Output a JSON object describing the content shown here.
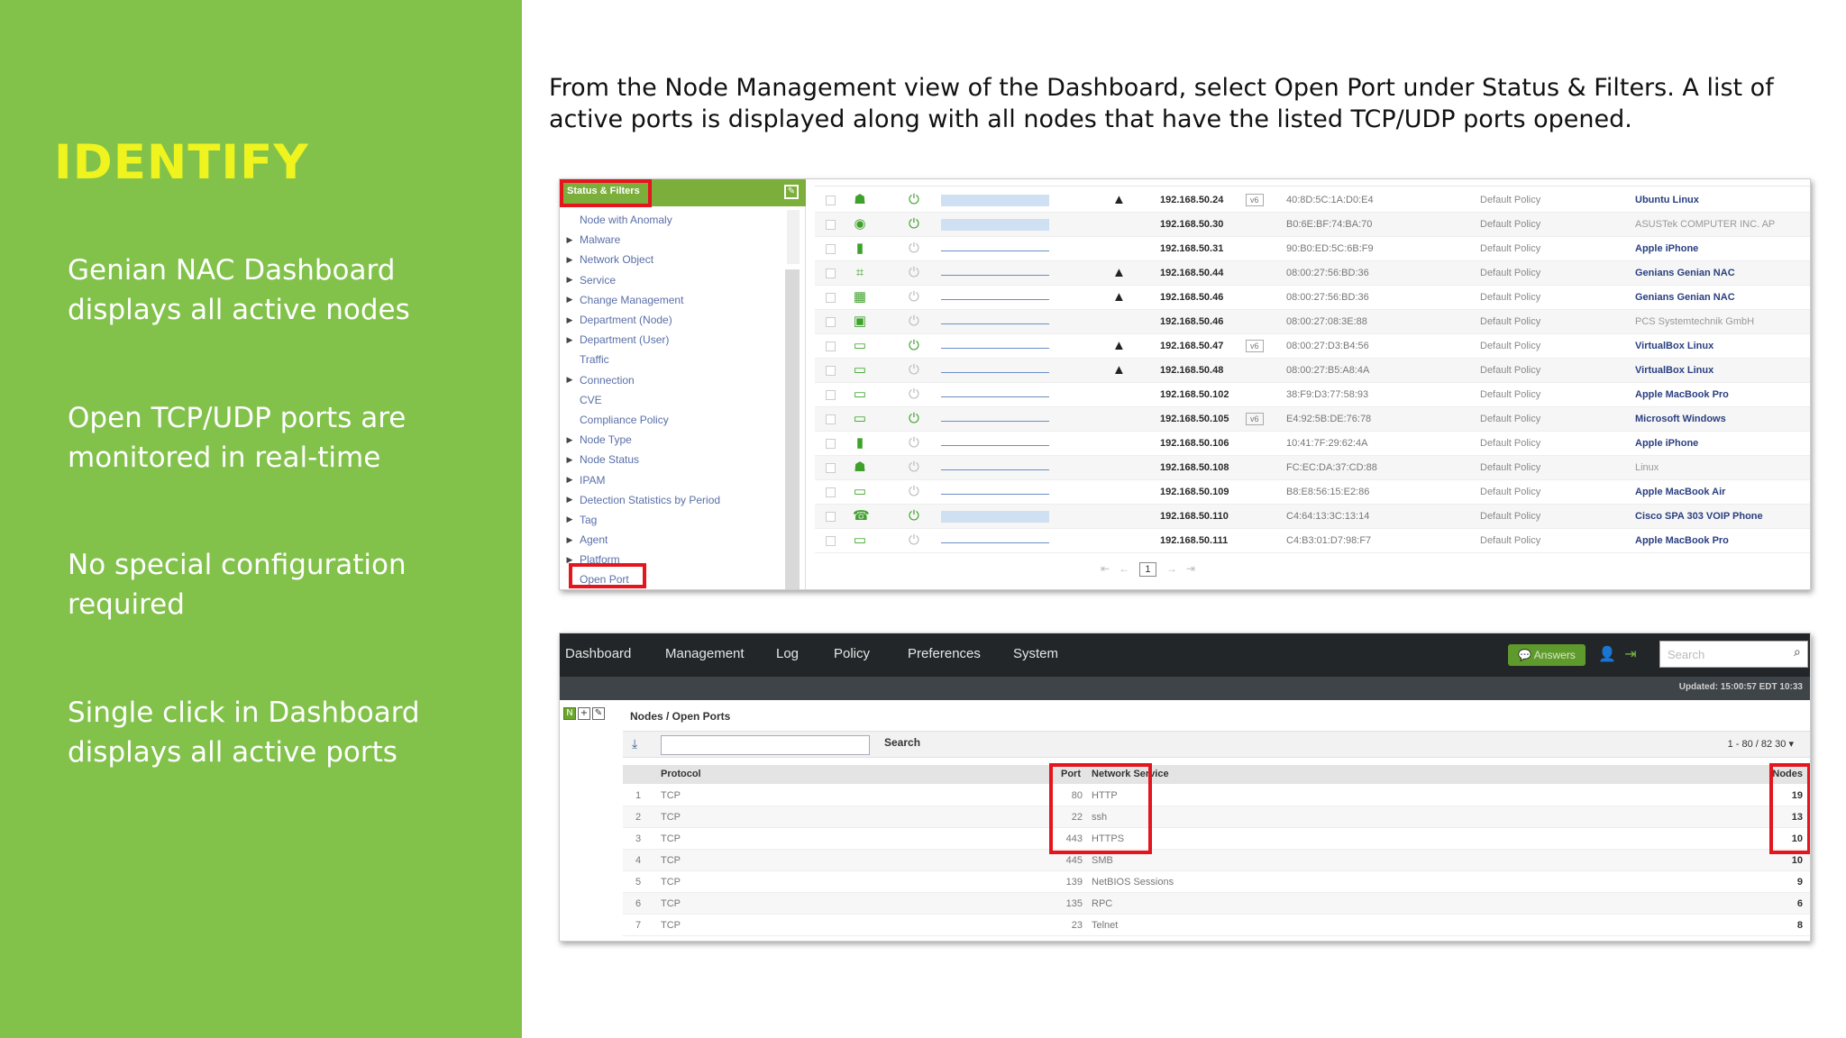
{
  "slide": {
    "title": "IDENTIFY",
    "bullets": [
      "Genian NAC Dashboard displays all active nodes",
      "Open TCP/UDP ports are monitored in real-time",
      "No special configuration required",
      "Single click in Dashboard displays all active ports"
    ],
    "intro": "From the Node Management view of the Dashboard, select Open Port under Status & Filters.  A list of active ports is displayed along with all nodes that have the listed TCP/UDP ports opened."
  },
  "colors": {
    "left_panel": "#82c24b",
    "title": "#f0f41e",
    "highlight": "#e4151d"
  },
  "node_view": {
    "filters_header": "Status & Filters",
    "filters": [
      {
        "label": "Node with Anomaly",
        "expandable": false
      },
      {
        "label": "Malware",
        "expandable": true
      },
      {
        "label": "Network Object",
        "expandable": true
      },
      {
        "label": "Service",
        "expandable": true
      },
      {
        "label": "Change Management",
        "expandable": true
      },
      {
        "label": "Department (Node)",
        "expandable": true
      },
      {
        "label": "Department (User)",
        "expandable": true
      },
      {
        "label": "Traffic",
        "expandable": false
      },
      {
        "label": "Connection",
        "expandable": true
      },
      {
        "label": "CVE",
        "expandable": false
      },
      {
        "label": "Compliance Policy",
        "expandable": false
      },
      {
        "label": "Node Type",
        "expandable": true
      },
      {
        "label": "Node Status",
        "expandable": true
      },
      {
        "label": "IPAM",
        "expandable": true
      },
      {
        "label": "Detection Statistics by Period",
        "expandable": true
      },
      {
        "label": "Tag",
        "expandable": true
      },
      {
        "label": "Agent",
        "expandable": true
      },
      {
        "label": "Platform",
        "expandable": true
      },
      {
        "label": "Open Port",
        "expandable": false
      }
    ],
    "nodes": [
      {
        "icon": "network-icon",
        "power": "on",
        "traffic": "full",
        "warn": true,
        "ip": "192.168.50.24",
        "v6": true,
        "mac": "40:8D:5C:1A:D0:E4",
        "policy": "Default Policy",
        "platform": "Ubuntu Linux",
        "muted": false
      },
      {
        "icon": "wifi-icon",
        "power": "on",
        "traffic": "full",
        "warn": false,
        "ip": "192.168.50.30",
        "v6": false,
        "mac": "B0:6E:BF:74:BA:70",
        "policy": "Default Policy",
        "platform": "ASUSTek COMPUTER INC. AP",
        "muted": true
      },
      {
        "icon": "phone-icon",
        "power": "off",
        "traffic": "line",
        "warn": false,
        "ip": "192.168.50.31",
        "v6": false,
        "mac": "90:B0:ED:5C:6B:F9",
        "policy": "Default Policy",
        "platform": "Apple iPhone",
        "muted": false
      },
      {
        "icon": "hub-icon",
        "power": "off",
        "traffic": "line",
        "warn": true,
        "ip": "192.168.50.44",
        "v6": false,
        "mac": "08:00:27:56:BD:36",
        "policy": "Default Policy",
        "platform": "Genians Genian NAC",
        "muted": false
      },
      {
        "icon": "server-icon",
        "power": "off",
        "traffic": "line",
        "warn": true,
        "ip": "192.168.50.46",
        "v6": false,
        "mac": "08:00:27:56:BD:36",
        "policy": "Default Policy",
        "platform": "Genians Genian NAC",
        "muted": false
      },
      {
        "icon": "device-icon",
        "power": "off",
        "traffic": "line",
        "warn": false,
        "ip": "192.168.50.46",
        "v6": false,
        "mac": "08:00:27:08:3E:88",
        "policy": "Default Policy",
        "platform": "PCS Systemtechnik GmbH",
        "muted": true
      },
      {
        "icon": "monitor-icon",
        "power": "on",
        "traffic": "line",
        "warn": true,
        "ip": "192.168.50.47",
        "v6": true,
        "mac": "08:00:27:D3:B4:56",
        "policy": "Default Policy",
        "platform": "VirtualBox Linux",
        "muted": false
      },
      {
        "icon": "monitor-icon",
        "power": "off",
        "traffic": "line",
        "warn": true,
        "ip": "192.168.50.48",
        "v6": false,
        "mac": "08:00:27:B5:A8:4A",
        "policy": "Default Policy",
        "platform": "VirtualBox Linux",
        "muted": false
      },
      {
        "icon": "monitor-icon",
        "power": "off",
        "traffic": "line",
        "warn": false,
        "ip": "192.168.50.102",
        "v6": false,
        "mac": "38:F9:D3:77:58:93",
        "policy": "Default Policy",
        "platform": "Apple MacBook Pro",
        "muted": false
      },
      {
        "icon": "monitor-icon",
        "power": "on",
        "traffic": "line",
        "warn": false,
        "ip": "192.168.50.105",
        "v6": true,
        "mac": "E4:92:5B:DE:76:78",
        "policy": "Default Policy",
        "platform": "Microsoft Windows",
        "muted": false
      },
      {
        "icon": "phone-icon",
        "power": "off",
        "traffic": "line",
        "warn": false,
        "ip": "192.168.50.106",
        "v6": false,
        "mac": "10:41:7F:29:62:4A",
        "policy": "Default Policy",
        "platform": "Apple iPhone",
        "muted": false
      },
      {
        "icon": "network-icon",
        "power": "off",
        "traffic": "line",
        "warn": false,
        "ip": "192.168.50.108",
        "v6": false,
        "mac": "FC:EC:DA:37:CD:88",
        "policy": "Default Policy",
        "platform": "Linux",
        "muted": true
      },
      {
        "icon": "monitor-icon",
        "power": "off",
        "traffic": "line",
        "warn": false,
        "ip": "192.168.50.109",
        "v6": false,
        "mac": "B8:E8:56:15:E2:86",
        "policy": "Default Policy",
        "platform": "Apple MacBook Air",
        "muted": false
      },
      {
        "icon": "voip-icon",
        "power": "on",
        "traffic": "full",
        "warn": false,
        "ip": "192.168.50.110",
        "v6": false,
        "mac": "C4:64:13:3C:13:14",
        "policy": "Default Policy",
        "platform": "Cisco SPA 303 VOIP Phone",
        "muted": false
      },
      {
        "icon": "monitor-icon",
        "power": "off",
        "traffic": "line",
        "warn": false,
        "ip": "192.168.50.111",
        "v6": false,
        "mac": "C4:B3:01:D7:98:F7",
        "policy": "Default Policy",
        "platform": "Apple MacBook Pro",
        "muted": false
      }
    ],
    "pager_current": "1"
  },
  "ports_view": {
    "nav": [
      "Dashboard",
      "Management",
      "Log",
      "Policy",
      "Preferences",
      "System"
    ],
    "answers": "Answers",
    "search_placeholder": "Search",
    "updated": "Updated: 15:00:57 EDT  10:33",
    "breadcrumb": "Nodes / Open Ports",
    "search_button": "Search",
    "pagination": "1 - 80 / 82   30   ▾",
    "headers": {
      "protocol": "Protocol",
      "port": "Port",
      "service": "Network Service",
      "nodes": "Nodes"
    },
    "rows": [
      {
        "num": "1",
        "protocol": "TCP",
        "port": "80",
        "service": "HTTP",
        "nodes": "19"
      },
      {
        "num": "2",
        "protocol": "TCP",
        "port": "22",
        "service": "ssh",
        "nodes": "13"
      },
      {
        "num": "3",
        "protocol": "TCP",
        "port": "443",
        "service": "HTTPS",
        "nodes": "10"
      },
      {
        "num": "4",
        "protocol": "TCP",
        "port": "445",
        "service": "SMB",
        "nodes": "10"
      },
      {
        "num": "5",
        "protocol": "TCP",
        "port": "139",
        "service": "NetBIOS Sessions",
        "nodes": "9"
      },
      {
        "num": "6",
        "protocol": "TCP",
        "port": "135",
        "service": "RPC",
        "nodes": "6"
      },
      {
        "num": "7",
        "protocol": "TCP",
        "port": "23",
        "service": "Telnet",
        "nodes": "8"
      }
    ]
  }
}
